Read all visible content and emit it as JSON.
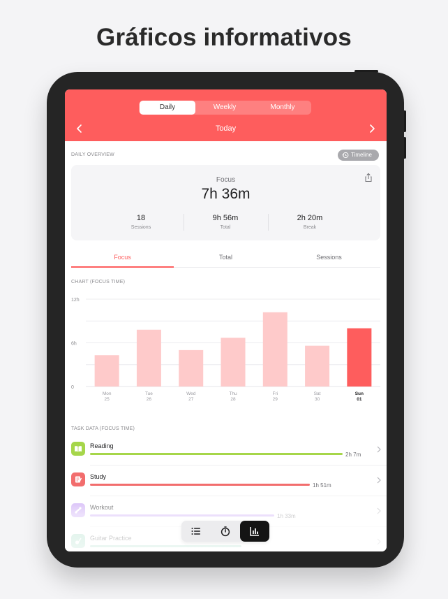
{
  "headline": "Gráficos informativos",
  "header": {
    "tabs": [
      "Daily",
      "Weekly",
      "Monthly"
    ],
    "active_tab": "Daily",
    "title": "Today",
    "accent_color": "#fe5d5d"
  },
  "overview": {
    "section_label": "DAILY OVERVIEW",
    "timeline_label": "Timeline",
    "title": "Focus",
    "value": "7h 36m",
    "stats": [
      {
        "value": "18",
        "label": "Sessions"
      },
      {
        "value": "9h 56m",
        "label": "Total"
      },
      {
        "value": "2h 20m",
        "label": "Break"
      }
    ]
  },
  "metric_tabs": [
    "Focus",
    "Total",
    "Sessions"
  ],
  "chart_section_label": "CHART (FOCUS TIME)",
  "chart_data": {
    "type": "bar",
    "title": "",
    "categories": [
      "Mon 25",
      "Tue 26",
      "Wed 27",
      "Thu 28",
      "Fri 29",
      "Sat 30",
      "Sun 01"
    ],
    "days": [
      "Mon",
      "Tue",
      "Wed",
      "Thu",
      "Fri",
      "Sat",
      "Sun"
    ],
    "dates": [
      "25",
      "26",
      "27",
      "28",
      "29",
      "30",
      "01"
    ],
    "values": [
      4.3,
      7.8,
      5.0,
      6.7,
      10.2,
      5.6,
      8.0
    ],
    "highlight_index": 6,
    "yticks": [
      "12h",
      "6h",
      "0"
    ],
    "ylim": [
      0,
      12
    ],
    "bar_color": "#fecaca",
    "highlight_color": "#fe5d5d",
    "grid": true
  },
  "tasks": {
    "section_label": "TASK DATA (FOCUS TIME)",
    "items": [
      {
        "name": "Reading",
        "duration": "2h 7m",
        "color": "#a6d64a",
        "fill": 1.0
      },
      {
        "name": "Study",
        "duration": "1h 51m",
        "color": "#f26d6d",
        "fill": 0.87
      },
      {
        "name": "Workout",
        "duration": "1h 33m",
        "color": "#c9a6f5",
        "fill": 0.73
      },
      {
        "name": "Guitar Practice",
        "duration": "",
        "color": "#8fd3b6",
        "fill": 0.6
      }
    ]
  },
  "bottom_bar": {
    "icons": [
      "list-icon",
      "timer-icon",
      "stats-icon"
    ],
    "active": "stats-icon"
  }
}
